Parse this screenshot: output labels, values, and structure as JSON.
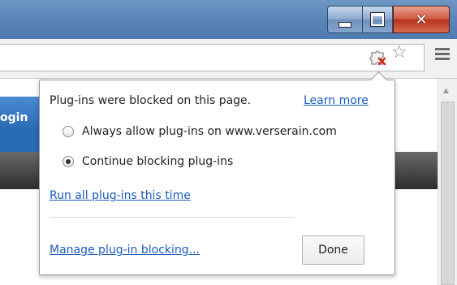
{
  "window": {
    "minimize_icon": "minimize-icon",
    "maximize_icon": "maximize-icon",
    "close_icon": "close-icon"
  },
  "toolbar": {
    "plugin_blocked_icon": "puzzle-blocked-icon",
    "bookmark_icon": "star-icon",
    "menu_icon": "hamburger-menu-icon"
  },
  "page": {
    "login_text": "ogin"
  },
  "bubble": {
    "title": "Plug-ins were blocked on this page.",
    "learn_more": "Learn more",
    "options": [
      {
        "label": "Always allow plug-ins on www.verserain.com",
        "checked": false
      },
      {
        "label": "Continue blocking plug-ins",
        "checked": true
      }
    ],
    "run_all": "Run all plug-ins this time",
    "manage": "Manage plug-in blocking...",
    "done": "Done"
  },
  "colors": {
    "link": "#1a5bbd",
    "titlebar": "#5b86b9",
    "close_button": "#c7432b"
  }
}
